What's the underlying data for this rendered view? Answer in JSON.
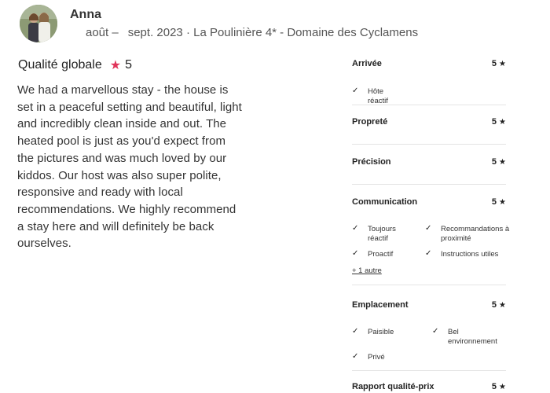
{
  "reviewer": {
    "name": "Anna",
    "stay_month": "août –",
    "stay_details": "sept. 2023 · La Poulinière 4* - Domaine des Cyclamens"
  },
  "overall": {
    "label": "Qualité globale",
    "score": "5",
    "star_color": "#e0345a"
  },
  "review_text": "We had a marvellous stay - the house is set in a peaceful setting and beautiful, light and incredibly clean inside and out. The heated pool is just as you'd expect from the pictures and was much loved by our kiddos. Our host was also super polite, responsive and ready with local recommendations. We highly recommend a stay here and will definitely be back ourselves.",
  "categories": [
    {
      "name": "Arrivée",
      "score": "5",
      "tags": [
        "Hôte réactif"
      ]
    },
    {
      "name": "Propreté",
      "score": "5",
      "tags": []
    },
    {
      "name": "Précision",
      "score": "5",
      "tags": []
    },
    {
      "name": "Communication",
      "score": "5",
      "tags": [
        "Toujours réactif",
        "Recommandations à proximité",
        "Proactif",
        "Instructions utiles"
      ],
      "more": "+ 1 autre"
    },
    {
      "name": "Emplacement",
      "score": "5",
      "tags": [
        "Paisible",
        "Bel environnement",
        "Privé"
      ]
    },
    {
      "name": "Rapport qualité-prix",
      "score": "5",
      "tags": []
    }
  ],
  "icons": {
    "star": "star-icon",
    "check": "check-icon"
  }
}
